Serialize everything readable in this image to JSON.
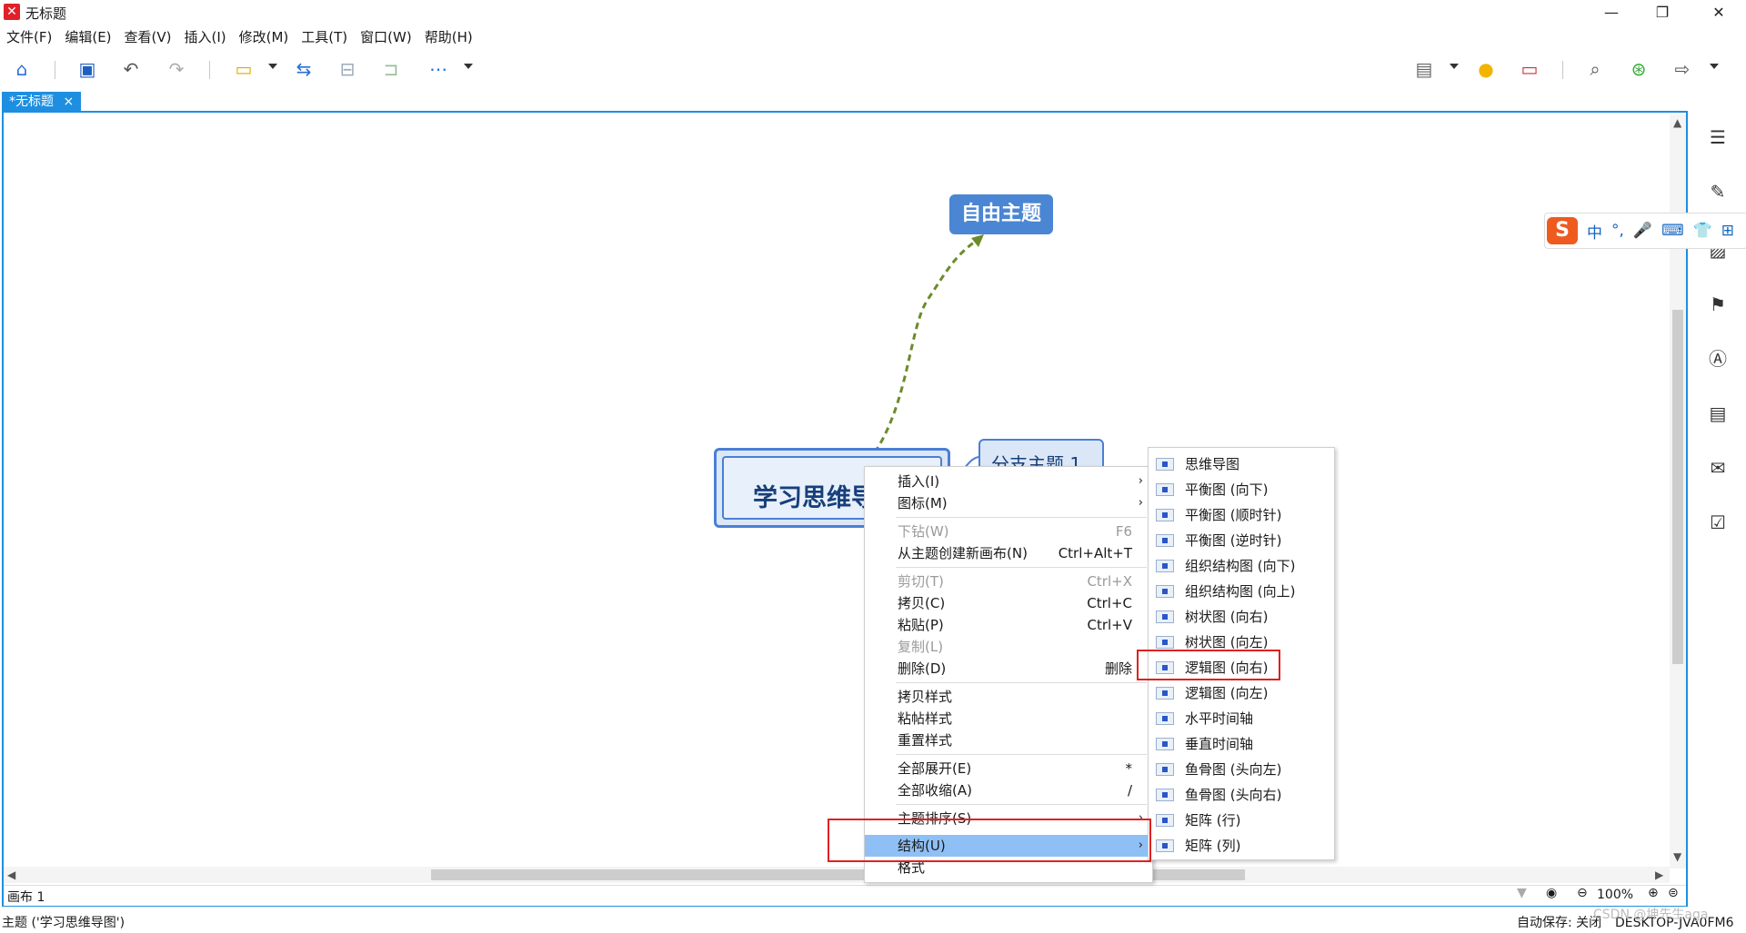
{
  "window": {
    "title": "无标题",
    "min": "—",
    "max": "❐",
    "close": "✕"
  },
  "menu": [
    "文件(F)",
    "编辑(E)",
    "查看(V)",
    "插入(I)",
    "修改(M)",
    "工具(T)",
    "窗口(W)",
    "帮助(H)"
  ],
  "tab": {
    "label": "*无标题",
    "close": "×"
  },
  "map": {
    "central": "学习思维导图",
    "branch": "分支主题 1",
    "floating": "自由主题"
  },
  "context_menu": {
    "items": [
      {
        "label": "插入(I)",
        "submenu": "›"
      },
      {
        "label": "图标(M)",
        "submenu": "›"
      },
      {
        "label": "下钻(W)",
        "shortcut": "F6"
      },
      {
        "label": "从主题创建新画布(N)",
        "shortcut": "Ctrl+Alt+T"
      },
      {
        "label": "剪切(T)",
        "shortcut": "Ctrl+X"
      },
      {
        "label": "拷贝(C)",
        "shortcut": "Ctrl+C"
      },
      {
        "label": "粘贴(P)",
        "shortcut": "Ctrl+V"
      },
      {
        "label": "复制(L)"
      },
      {
        "label": "删除(D)",
        "shortcut": "删除"
      },
      {
        "label": "拷贝样式"
      },
      {
        "label": "粘帖样式"
      },
      {
        "label": "重置样式"
      },
      {
        "label": "全部展开(E)",
        "shortcut": "*"
      },
      {
        "label": "全部收缩(A)",
        "shortcut": "/"
      },
      {
        "label": "主题排序(S)",
        "submenu": "›"
      },
      {
        "label": "结构(U)",
        "submenu": "›"
      },
      {
        "label": "格式"
      }
    ]
  },
  "structure_submenu": {
    "items": [
      "思维导图",
      "平衡图 (向下)",
      "平衡图 (顺时针)",
      "平衡图 (逆时针)",
      "组织结构图 (向下)",
      "组织结构图 (向上)",
      "树状图 (向右)",
      "树状图 (向左)",
      "逻辑图 (向右)",
      "逻辑图 (向左)",
      "水平时间轴",
      "垂直时间轴",
      "鱼骨图 (头向左)",
      "鱼骨图 (头向右)",
      "矩阵 (行)",
      "矩阵 (列)"
    ]
  },
  "ime": {
    "items": [
      "中",
      "°,",
      "🎤",
      "⌨",
      "👕",
      "⊞"
    ]
  },
  "sheet": {
    "name": "画布 1",
    "zoom": "100%"
  },
  "status": {
    "left": "主题 ('学习思维导图')",
    "autosave": "自动保存: 关闭",
    "machine": "DESKTOP-JVA0FM6",
    "watermark": "CSDN @坤先生aga"
  },
  "colors": {
    "accent": "#1e8fe0",
    "node_border": "#4a7fd4",
    "highlight": "#8fc0f5",
    "redbox": "#e02020"
  }
}
